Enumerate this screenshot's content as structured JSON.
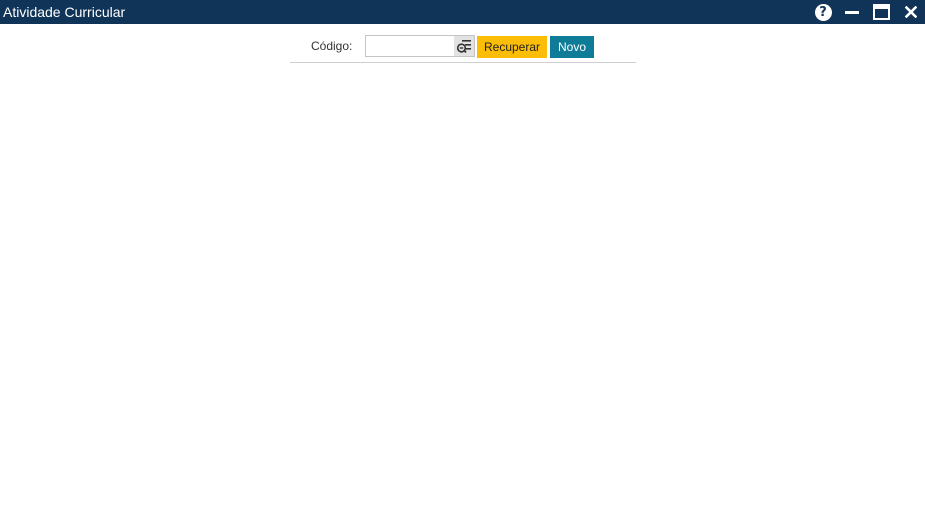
{
  "window": {
    "title": "Atividade Curricular",
    "controls": {
      "help": "?",
      "help_icon": "help-circle-icon",
      "minimize_icon": "minimize-icon",
      "maximize_icon": "maximize-icon",
      "close_icon": "close-icon"
    }
  },
  "toolbar": {
    "codigo_label": "Código:",
    "codigo_value": "",
    "codigo_placeholder": "",
    "lookup_icon": "search-list-icon",
    "recuperar_label": "Recuperar",
    "novo_label": "Novo"
  },
  "colors": {
    "titlebar": "#0f3458",
    "recuperar": "#fbbd08",
    "novo": "#0e7c97"
  }
}
